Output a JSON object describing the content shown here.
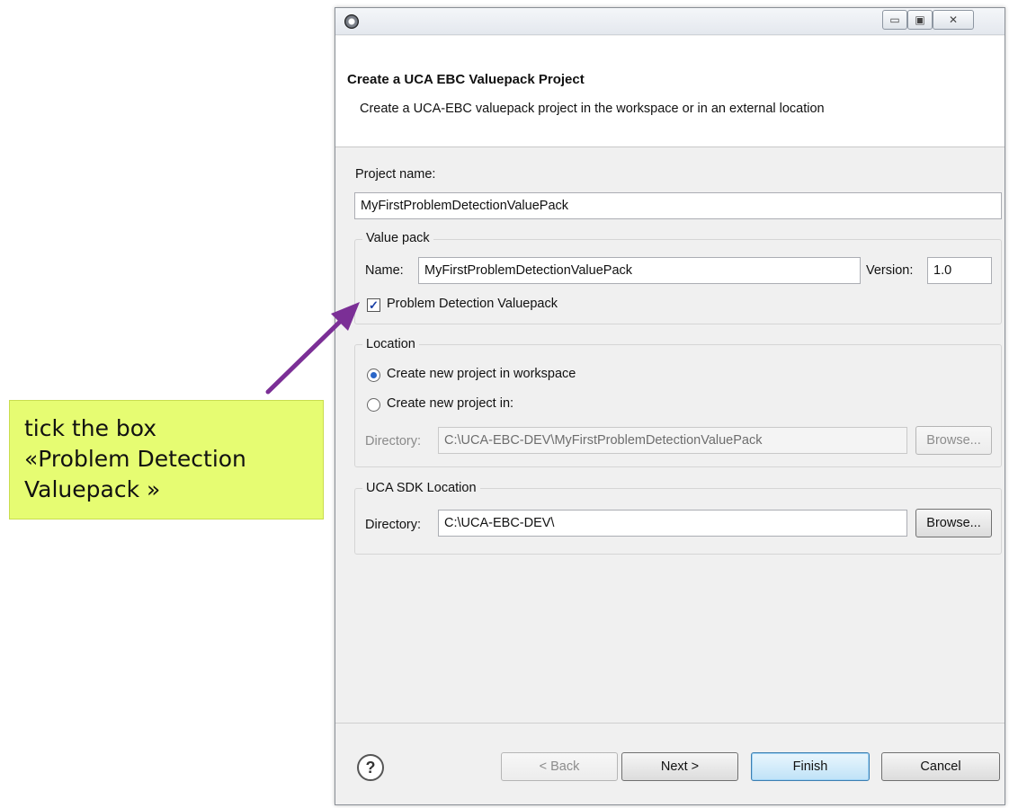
{
  "window": {
    "app_icon": "eclipse-icon",
    "title": "",
    "controls": {
      "minimize": "▭",
      "maximize": "▣",
      "close": "✕"
    }
  },
  "header": {
    "title": "Create a UCA EBC Valuepack Project",
    "description": "Create a UCA-EBC valuepack project in the workspace or in an external location"
  },
  "project": {
    "name_label": "Project name:",
    "name_value": "MyFirstProblemDetectionValuePack"
  },
  "value_pack": {
    "group_label": "Value pack",
    "name_label": "Name:",
    "name_value": "MyFirstProblemDetectionValuePack",
    "version_label": "Version:",
    "version_value": "1.0",
    "checkbox_label": "Problem Detection Valuepack",
    "checkbox_checked": true,
    "check_glyph": "✓"
  },
  "location": {
    "group_label": "Location",
    "option_workspace": "Create new project in workspace",
    "option_custom": "Create new project in:",
    "selected": "workspace",
    "directory_label": "Directory:",
    "directory_value": "C:\\UCA-EBC-DEV\\MyFirstProblemDetectionValuePack",
    "browse_label": "Browse..."
  },
  "sdk": {
    "group_label": "UCA SDK Location",
    "directory_label": "Directory:",
    "directory_value": "C:\\UCA-EBC-DEV\\",
    "browse_label": "Browse..."
  },
  "footer": {
    "help_icon": "help-icon",
    "help_glyph": "?",
    "back_label": "< Back",
    "next_label": "Next >",
    "finish_label": "Finish",
    "cancel_label": "Cancel"
  },
  "annotation": {
    "text": "tick the box\n«Problem Detection\nValuepack »",
    "background": "#e6fc72",
    "arrow_color": "#7b2f96"
  }
}
